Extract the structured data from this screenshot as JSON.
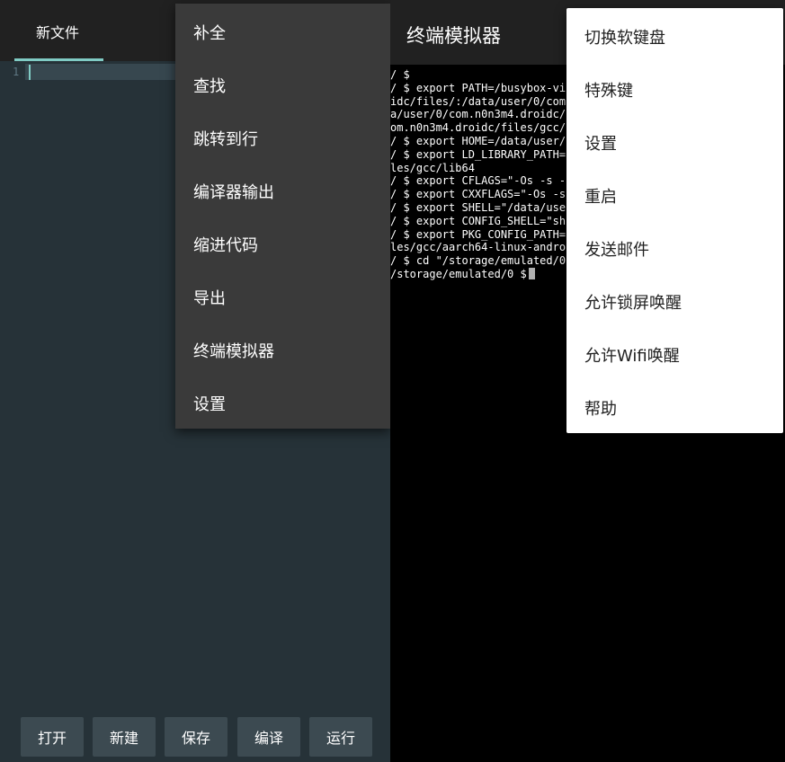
{
  "editor": {
    "tab_label": "新文件",
    "line_number": "1",
    "buttons": {
      "open": "打开",
      "new": "新建",
      "save": "保存",
      "compile": "编译",
      "run": "运行"
    }
  },
  "editor_menu": {
    "items": [
      "补全",
      "查找",
      "跳转到行",
      "编译器输出",
      "缩进代码",
      "导出",
      "终端模拟器",
      "设置"
    ]
  },
  "terminal": {
    "title": "终端模拟器",
    "lines": [
      "/ $",
      "/ $ export PATH=/busybox-vi",
      "idc/files/:/data/user/0/com",
      "a/user/0/com.n0n3m4.droidc/",
      "om.n0n3m4.droidc/files/gcc/",
      "/ $ export HOME=/data/user/",
      "/ $ export LD_LIBRARY_PATH=",
      "les/gcc/lib64",
      "/ $ export CFLAGS=\"-Os -s -",
      "/ $ export CXXFLAGS=\"-Os -s",
      "/ $ export SHELL=\"/data/use",
      "/ $ export CONFIG_SHELL=\"sh",
      "/ $ export PKG_CONFIG_PATH=",
      "les/gcc/aarch64-linux-andro",
      "/ $ cd \"/storage/emulated/0"
    ],
    "prompt": "/storage/emulated/0 $"
  },
  "terminal_menu": {
    "items": [
      "切换软键盘",
      "特殊键",
      "设置",
      "重启",
      "发送邮件",
      "允许锁屏唤醒",
      "允许Wifi唤醒",
      "帮助"
    ]
  }
}
